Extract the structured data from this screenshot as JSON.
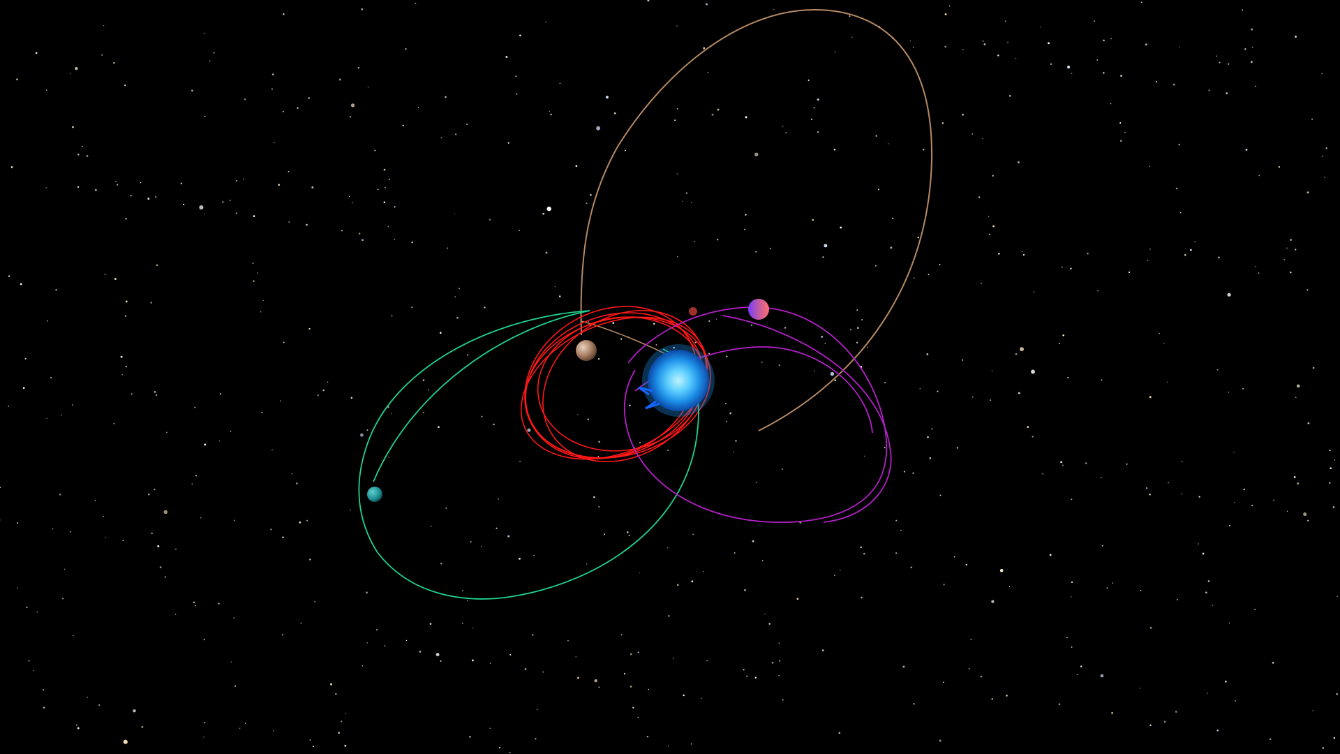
{
  "scene": {
    "background_color": "#000000",
    "star_color": "#ffffff"
  },
  "central_star": {
    "icon": "blue-star",
    "color": "#2fb8ff"
  },
  "orbits": [
    {
      "name": "orbit-tan",
      "color": "#b68a64"
    },
    {
      "name": "orbit-red",
      "color": "#ff1010"
    },
    {
      "name": "orbit-green",
      "color": "#1fd58f"
    },
    {
      "name": "orbit-magenta",
      "color": "#b51fc9"
    }
  ],
  "bodies": [
    {
      "name": "planet-tan",
      "color": "#b08066"
    },
    {
      "name": "planet-teal",
      "color": "#1b8c90"
    },
    {
      "name": "planet-pink",
      "color": "#e0638c"
    },
    {
      "name": "planet-small-red",
      "color": "#a0302a"
    }
  ]
}
